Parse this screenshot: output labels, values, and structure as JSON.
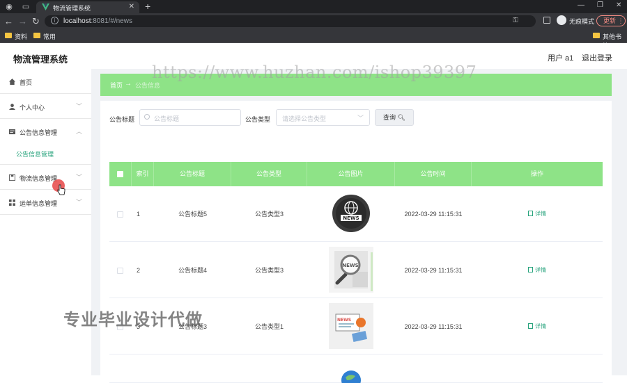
{
  "browser": {
    "tab_title": "物流管理系统",
    "url_host": "localhost",
    "url_rest": ":8081/#/news",
    "incognito_label": "无痕模式",
    "update_label": "更新",
    "bookmarks": [
      "资料",
      "常用"
    ],
    "other_bookmarks": "其他书签"
  },
  "app": {
    "brand": "物流管理系统",
    "user_label": "用户 a1",
    "logout_label": "退出登录"
  },
  "sidebar": {
    "items": [
      {
        "label": "首页",
        "icon": "home-icon"
      },
      {
        "label": "个人中心",
        "icon": "user-icon"
      },
      {
        "label": "公告信息管理",
        "icon": "notice-icon",
        "expanded": true
      },
      {
        "label": "物流信息管理",
        "icon": "box-icon"
      },
      {
        "label": "运单信息管理",
        "icon": "grid-icon"
      }
    ],
    "sub_item": "公告信息管理"
  },
  "breadcrumb": {
    "home": "首页",
    "current": "公告信息"
  },
  "filters": {
    "title_label": "公告标题",
    "title_placeholder": "公告标题",
    "type_label": "公告类型",
    "type_placeholder": "请选择公告类型",
    "search_button": "查询"
  },
  "table": {
    "headers": [
      "索引",
      "公告标题",
      "公告类型",
      "公告图片",
      "公告时间",
      "操作"
    ],
    "rows": [
      {
        "index": "1",
        "title": "公告标题5",
        "type": "公告类型3",
        "image": "news-globe",
        "time": "2022-03-29 11:15:31",
        "action": "详情"
      },
      {
        "index": "2",
        "title": "公告标题4",
        "type": "公告类型3",
        "image": "news-magnifier",
        "time": "2022-03-29 11:15:31",
        "action": "详情"
      },
      {
        "index": "3",
        "title": "公告标题3",
        "type": "公告类型1",
        "image": "news-laptop",
        "time": "2022-03-29 11:15:31",
        "action": "详情"
      }
    ]
  },
  "watermarks": {
    "url": "https://www.huzhan.com/ishop39397",
    "chinese": "专业毕业设计代做"
  },
  "colors": {
    "accent_green": "#8ee387",
    "link_green": "#27a37c",
    "browser_dark": "#202124"
  }
}
